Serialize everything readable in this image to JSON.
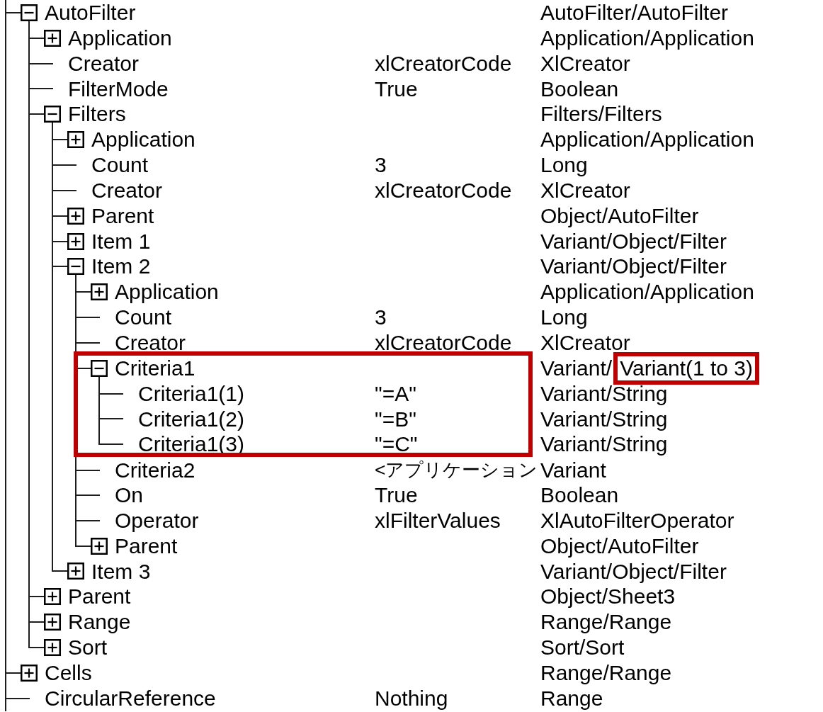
{
  "tree": [
    {
      "name": "AutoFilter",
      "kind": "group",
      "expanded": true,
      "highlighted": false,
      "type": "AutoFilter/AutoFilter",
      "children": [
        {
          "name": "Application",
          "kind": "group",
          "expanded": false,
          "highlighted": false,
          "type": "Application/Application"
        },
        {
          "name": "Creator",
          "kind": "leaf",
          "highlighted": false,
          "value": "xlCreatorCode",
          "type": "XlCreator"
        },
        {
          "name": "FilterMode",
          "kind": "leaf",
          "highlighted": false,
          "value": "True",
          "type": "Boolean"
        },
        {
          "name": "Filters",
          "kind": "group",
          "expanded": true,
          "highlighted": false,
          "type": "Filters/Filters",
          "children": [
            {
              "name": "Application",
              "kind": "group",
              "expanded": false,
              "highlighted": false,
              "type": "Application/Application"
            },
            {
              "name": "Count",
              "kind": "leaf",
              "highlighted": false,
              "value": "3",
              "type": "Long"
            },
            {
              "name": "Creator",
              "kind": "leaf",
              "highlighted": false,
              "value": "xlCreatorCode",
              "type": "XlCreator"
            },
            {
              "name": "Parent",
              "kind": "group",
              "expanded": false,
              "highlighted": false,
              "type": "Object/AutoFilter"
            },
            {
              "name": "Item 1",
              "kind": "group",
              "expanded": false,
              "highlighted": false,
              "type": "Variant/Object/Filter"
            },
            {
              "name": "Item 2",
              "kind": "group",
              "expanded": true,
              "highlighted": false,
              "type": "Variant/Object/Filter",
              "children": [
                {
                  "name": "Application",
                  "kind": "group",
                  "expanded": false,
                  "highlighted": false,
                  "type": "Application/Application"
                },
                {
                  "name": "Count",
                  "kind": "leaf",
                  "highlighted": false,
                  "value": "3",
                  "type": "Long"
                },
                {
                  "name": "Creator",
                  "kind": "leaf",
                  "highlighted": false,
                  "value": "xlCreatorCode",
                  "type": "XlCreator"
                },
                {
                  "name": "Criteria1",
                  "kind": "group",
                  "expanded": true,
                  "highlighted": true,
                  "type_parts": [
                    {
                      "text": "Variant/",
                      "highlighted": false
                    },
                    {
                      "text": "Variant(1 to 3)",
                      "highlighted": true
                    }
                  ],
                  "children": [
                    {
                      "name": "Criteria1(1)",
                      "kind": "leaf",
                      "highlighted": false,
                      "value": "\"=A\"",
                      "type": "Variant/String"
                    },
                    {
                      "name": "Criteria1(2)",
                      "kind": "leaf",
                      "highlighted": false,
                      "value": "\"=B\"",
                      "type": "Variant/String"
                    },
                    {
                      "name": "Criteria1(3)",
                      "kind": "leaf",
                      "highlighted": false,
                      "value": "\"=C\"",
                      "type": "Variant/String"
                    }
                  ]
                },
                {
                  "name": "Criteria2",
                  "kind": "leaf",
                  "highlighted": false,
                  "value": "<アプリケーション",
                  "type": "Variant"
                },
                {
                  "name": "On",
                  "kind": "leaf",
                  "highlighted": false,
                  "value": "True",
                  "type": "Boolean"
                },
                {
                  "name": "Operator",
                  "kind": "leaf",
                  "highlighted": false,
                  "value": "xlFilterValues",
                  "type": "XlAutoFilterOperator"
                },
                {
                  "name": "Parent",
                  "kind": "group",
                  "expanded": false,
                  "highlighted": false,
                  "type": "Object/AutoFilter"
                }
              ]
            },
            {
              "name": "Item 3",
              "kind": "group",
              "expanded": false,
              "highlighted": false,
              "type": "Variant/Object/Filter"
            }
          ]
        },
        {
          "name": "Parent",
          "kind": "group",
          "expanded": false,
          "highlighted": false,
          "type": "Object/Sheet3"
        },
        {
          "name": "Range",
          "kind": "group",
          "expanded": false,
          "highlighted": false,
          "type": "Range/Range"
        },
        {
          "name": "Sort",
          "kind": "group",
          "expanded": false,
          "highlighted": false,
          "type": "Sort/Sort"
        }
      ]
    },
    {
      "name": "Cells",
      "kind": "group",
      "expanded": false,
      "highlighted": false,
      "type": "Range/Range"
    },
    {
      "name": "CircularReference",
      "kind": "leaf",
      "highlighted": false,
      "value": "Nothing",
      "type": "Range"
    }
  ]
}
